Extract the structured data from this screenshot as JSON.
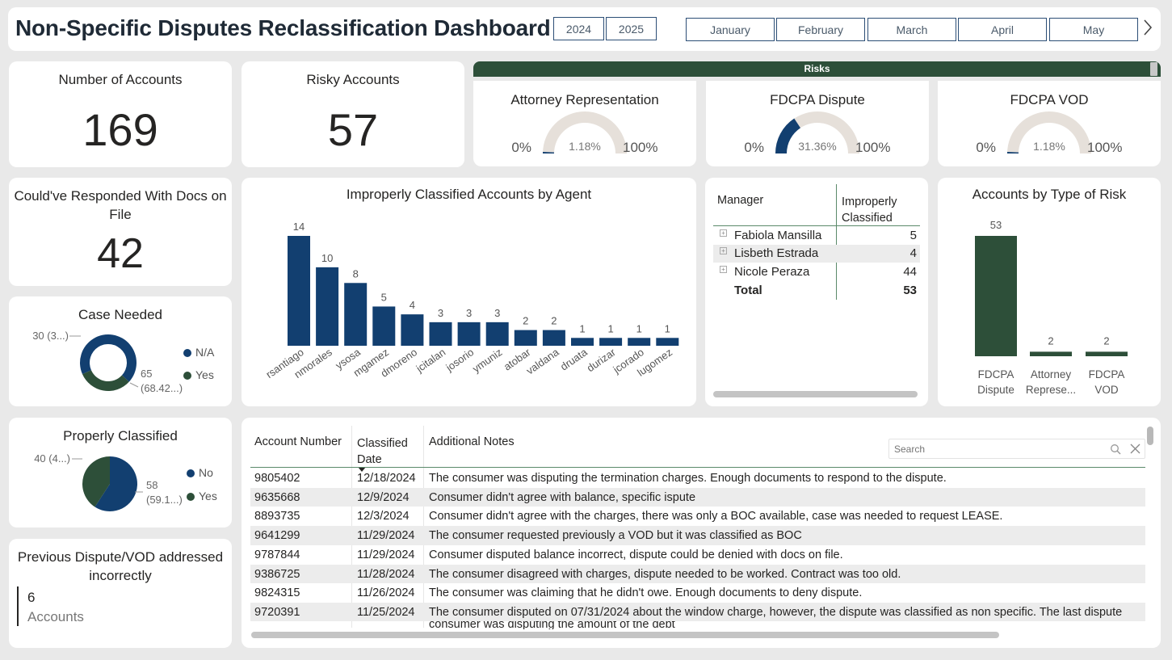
{
  "title": "Non-Specific Disputes Reclassification Dashboard",
  "years": [
    "2024",
    "2025"
  ],
  "months": [
    "January",
    "February",
    "March",
    "April",
    "May"
  ],
  "colors": {
    "navy": "#123f70",
    "green": "#2d4f39",
    "gauge_bg": "#e6e0da"
  },
  "kpis": {
    "accounts": {
      "label": "Number of Accounts",
      "value": "169"
    },
    "risky": {
      "label": "Risky Accounts",
      "value": "57"
    },
    "docs": {
      "label": "Could've Responded With Docs on File",
      "value": "42"
    }
  },
  "risks_header": "Risks",
  "gauges": [
    {
      "title": "Attorney Representation",
      "min_label": "0%",
      "max_label": "100%",
      "value_label": "1.18%",
      "fraction": 0.0118
    },
    {
      "title": "FDCPA Dispute",
      "min_label": "0%",
      "max_label": "100%",
      "value_label": "31.36%",
      "fraction": 0.3136
    },
    {
      "title": "FDCPA VOD",
      "min_label": "0%",
      "max_label": "100%",
      "value_label": "1.18%",
      "fraction": 0.0118
    }
  ],
  "agent_chart": {
    "title": "Improperly Classified Accounts by Agent",
    "chart_data": {
      "type": "bar",
      "categories": [
        "rsantiago",
        "nmorales",
        "ysosa",
        "mgamez",
        "dmoreno",
        "jcitalan",
        "josorio",
        "ymuniz",
        "atobar",
        "valdana",
        "druata",
        "durizar",
        "jcorado",
        "lugomez"
      ],
      "values": [
        14,
        10,
        8,
        5,
        4,
        3,
        3,
        3,
        2,
        2,
        1,
        1,
        1,
        1
      ],
      "data_labels": [
        "14",
        "10",
        "8",
        "5",
        "4",
        "3",
        "3",
        "3",
        "2",
        "2",
        "1",
        "1",
        "1",
        "1"
      ]
    }
  },
  "manager_table": {
    "headers": [
      "Manager",
      "Improperly Classified"
    ],
    "rows": [
      {
        "name": "Fabiola Mansilla",
        "value": "5"
      },
      {
        "name": "Lisbeth Estrada",
        "value": "4"
      },
      {
        "name": "Nicole Peraza",
        "value": "44"
      }
    ],
    "total_label": "Total",
    "total_value": "53"
  },
  "risk_type_chart": {
    "title": "Accounts by Type of Risk",
    "chart_data": {
      "type": "bar",
      "categories": [
        [
          "FDCPA",
          "Dispute"
        ],
        [
          "Attorney",
          "Represe..."
        ],
        [
          "FDCPA",
          "VOD"
        ]
      ],
      "values": [
        53,
        2,
        2
      ],
      "data_labels": [
        "53",
        "2",
        "2"
      ]
    }
  },
  "case_needed": {
    "title": "Case Needed",
    "chart_data": {
      "type": "pie",
      "donut": true,
      "categories": [
        "N/A",
        "Yes"
      ],
      "values": [
        65,
        30
      ],
      "labels": [
        "65",
        "(68.42...)",
        "30 (3...)"
      ]
    },
    "legend": [
      "N/A",
      "Yes"
    ]
  },
  "properly_classified": {
    "title": "Properly Classified",
    "chart_data": {
      "type": "pie",
      "donut": false,
      "categories": [
        "No",
        "Yes"
      ],
      "values": [
        58,
        40
      ],
      "labels": [
        "58",
        "(59.1...)",
        "40 (4...)"
      ]
    },
    "legend": [
      "No",
      "Yes"
    ]
  },
  "previous_dispute": {
    "title": "Previous Dispute/VOD addressed incorrectly",
    "value": "6",
    "unit": "Accounts"
  },
  "notes_table": {
    "headers": [
      "Account Number",
      "Classified Date",
      "Additional Notes"
    ],
    "search_placeholder": "Search",
    "rows": [
      [
        "9805402",
        "12/18/2024",
        "The consumer was disputing the termination charges. Enough documents to respond to the dispute."
      ],
      [
        "9635668",
        "12/9/2024",
        "Consumer didn't agree with balance, specific ispute"
      ],
      [
        "8893735",
        "12/3/2024",
        "Consumer didn't agree with the charges, there was only a BOC available, case was needed to request LEASE."
      ],
      [
        "9641299",
        "11/29/2024",
        "The consumer requested previously a VOD but it was classified as BOC"
      ],
      [
        "9787844",
        "11/29/2024",
        "Consumer disputed balance incorrect, dispute could be denied with docs on file."
      ],
      [
        "9386725",
        "11/28/2024",
        "The consumer disagreed with charges, dispute needed to be worked. Contract was too old."
      ],
      [
        "9824315",
        "11/26/2024",
        "The consumer was claiming that he didn't owe. Enough documents to deny dispute."
      ],
      [
        "9720391",
        "11/25/2024",
        "The consumer disputed on 07/31/2024 about the window charge, however, the dispute was classified as non specific. The last dispute"
      ]
    ],
    "overflow_line": "consumer was disputing the amount of the debt"
  }
}
